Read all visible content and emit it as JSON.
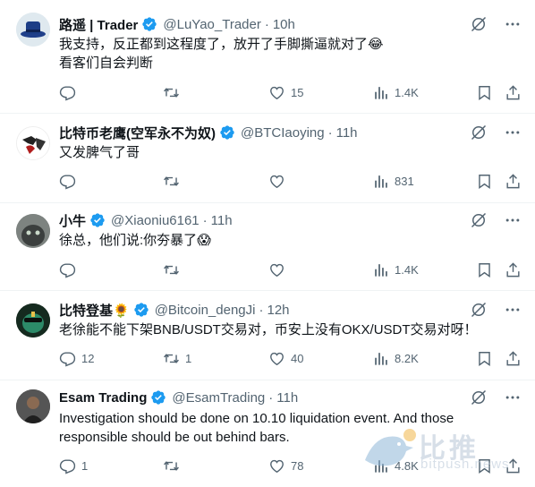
{
  "tweets": [
    {
      "name": "路遥 | Trader",
      "handle": "@LuYao_Trader",
      "time": "10h",
      "text_lines": [
        "我支持，反正都到这程度了，放开了手脚撕逼就对了😂",
        "看客们自会判断"
      ],
      "replies": "",
      "retweets": "",
      "likes": "15",
      "views": "1.4K"
    },
    {
      "name": "比特币老鹰(空军永不为奴)",
      "handle": "@BTCIaoying",
      "time": "11h",
      "text_lines": [
        "又发脾气了哥"
      ],
      "replies": "",
      "retweets": "",
      "likes": "",
      "views": "831"
    },
    {
      "name": "小牛",
      "handle": "@Xiaoniu6161",
      "time": "11h",
      "text_lines": [
        "徐总，他们说:你夯暴了😱"
      ],
      "replies": "",
      "retweets": "",
      "likes": "",
      "views": "1.4K"
    },
    {
      "name": "比特登基🌻",
      "handle": "@Bitcoin_dengJi",
      "time": "12h",
      "text_lines": [
        "老徐能不能下架BNB/USDT交易对，币安上没有OKX/USDT交易对呀！"
      ],
      "replies": "12",
      "retweets": "1",
      "likes": "40",
      "views": "8.2K"
    },
    {
      "name": "Esam Trading",
      "handle": "@EsamTrading",
      "time": "11h",
      "text_lines": [
        "Investigation should be done on 10.10 liquidation event. And those",
        "responsible should be out behind bars."
      ],
      "replies": "1",
      "retweets": "",
      "likes": "78",
      "views": "4.8K"
    }
  ],
  "watermark": {
    "cn": "比推",
    "en": "bitpush.news"
  },
  "icons": {
    "verified": "verified-badge-icon",
    "grok": "grok-icon",
    "more": "more-icon",
    "reply": "reply-icon",
    "retweet": "retweet-icon",
    "like": "heart-icon",
    "views": "views-icon",
    "bookmark": "bookmark-icon",
    "share": "share-icon"
  },
  "colors": {
    "verified": "#1d9bf0",
    "muted": "#536471",
    "text": "#0f1419",
    "divider": "#eff3f4"
  }
}
